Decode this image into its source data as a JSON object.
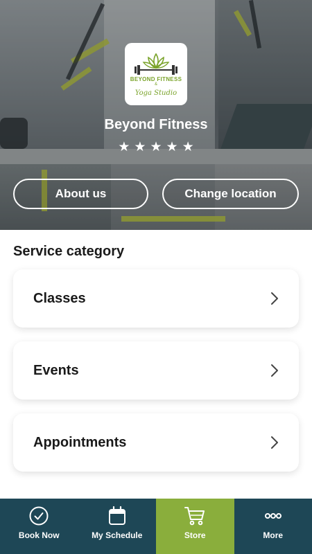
{
  "studio": {
    "name": "Beyond Fitness",
    "rating": 5,
    "logo_text_top": "BEYOND FITNESS",
    "logo_text_amp": "&",
    "logo_text_bottom": "Yoga Studio"
  },
  "hero_buttons": {
    "about": "About us",
    "change_location": "Change location"
  },
  "service": {
    "title": "Service category",
    "items": [
      {
        "label": "Classes"
      },
      {
        "label": "Events"
      },
      {
        "label": "Appointments"
      }
    ]
  },
  "bottom_nav": {
    "items": [
      {
        "label": "Book Now",
        "icon": "check-circle-icon"
      },
      {
        "label": "My Schedule",
        "icon": "calendar-icon"
      },
      {
        "label": "Store",
        "icon": "cart-icon",
        "active": true
      },
      {
        "label": "More",
        "icon": "more-dots-icon"
      }
    ]
  },
  "colors": {
    "nav_bg": "#1e4756",
    "nav_active": "#8aae3c",
    "brand_green": "#7aa32a"
  }
}
